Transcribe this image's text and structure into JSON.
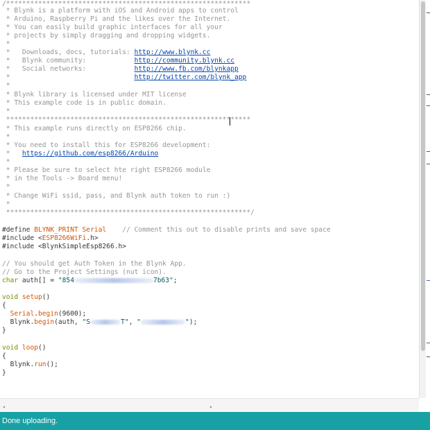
{
  "editor": {
    "comment_block": {
      "border_top": "/*************************************************************",
      "intro": [
        " * Blynk is a platform with iOS and Android apps to control",
        " * Arduino, Raspberry Pi and the likes over the Internet.",
        " * You can easily build graphic interfaces for all your",
        " * projects by simply dragging and dropping widgets."
      ],
      "star": " *",
      "links": [
        {
          "label": " *   Downloads, docs, tutorials: ",
          "url": "http://www.blynk.cc"
        },
        {
          "label": " *   Blynk community:            ",
          "url": "http://community.blynk.cc"
        },
        {
          "label": " *   Social networks:            ",
          "url": "http://www.fb.com/blynkapp"
        },
        {
          "label": " *                               ",
          "url": "http://twitter.com/blynk_app"
        }
      ],
      "license": [
        " * Blynk library is licensed under MIT license",
        " * This example code is in public domain."
      ],
      "separator": " *************************************************************",
      "esp_note": " * This example runs directly on ESP8266 chip.",
      "install_note": " * You need to install this for ESP8266 development:",
      "install_url_prefix": " *   ",
      "install_url": "https://github.com/esp8266/Arduino",
      "board_note": [
        " * Please be sure to select hte right ESP8266 module",
        " * in the Tools -> Board menu!"
      ],
      "change_note": " * Change WiFi ssid, pass, and Blynk auth token to run :)",
      "border_bottom": " *************************************************************/"
    },
    "code": {
      "define_kw": "#define",
      "define_name": " BLYNK_PRINT ",
      "define_val": "Serial",
      "define_comment": "    // Comment this out to disable prints and save space",
      "include_kw": "#include",
      "include1_open": " <",
      "include1_name": "ESP8266WiFi",
      "include1_close": ".h>",
      "include2": " <BlynkSimpleEsp8266.h>",
      "token_comment1": "// You should get Auth Token in the Blynk App.",
      "token_comment2": "// Go to the Project Settings (nut icon).",
      "char_kw": "char",
      "auth_decl": " auth[] = ",
      "auth_start": "\"854",
      "auth_end": "7b63\"",
      "semicolon": ";",
      "void_kw": "void",
      "setup_name": "setup",
      "parens": "()",
      "open_brace": "{",
      "close_brace": "}",
      "indent": "  ",
      "serial_obj": "Serial",
      "dot": ".",
      "begin_fn": "begin",
      "baud": "(9600);",
      "blynk_obj": "Blynk",
      "begin_args_open": "(auth, ",
      "ssid_start": "\"S",
      "ssid_end": "T\"",
      "comma": ", ",
      "pass_start": "\"",
      "pass_end": "\"",
      "begin_args_close": ");",
      "loop_name": "loop",
      "run_fn": "run",
      "run_args": "();"
    }
  },
  "status": {
    "message": "Done uploading."
  },
  "colors": {
    "status_bar": "#17a1a5",
    "keyword": "#5e6d03",
    "function": "#d35400",
    "literal": "#00979c",
    "comment": "#959595"
  }
}
